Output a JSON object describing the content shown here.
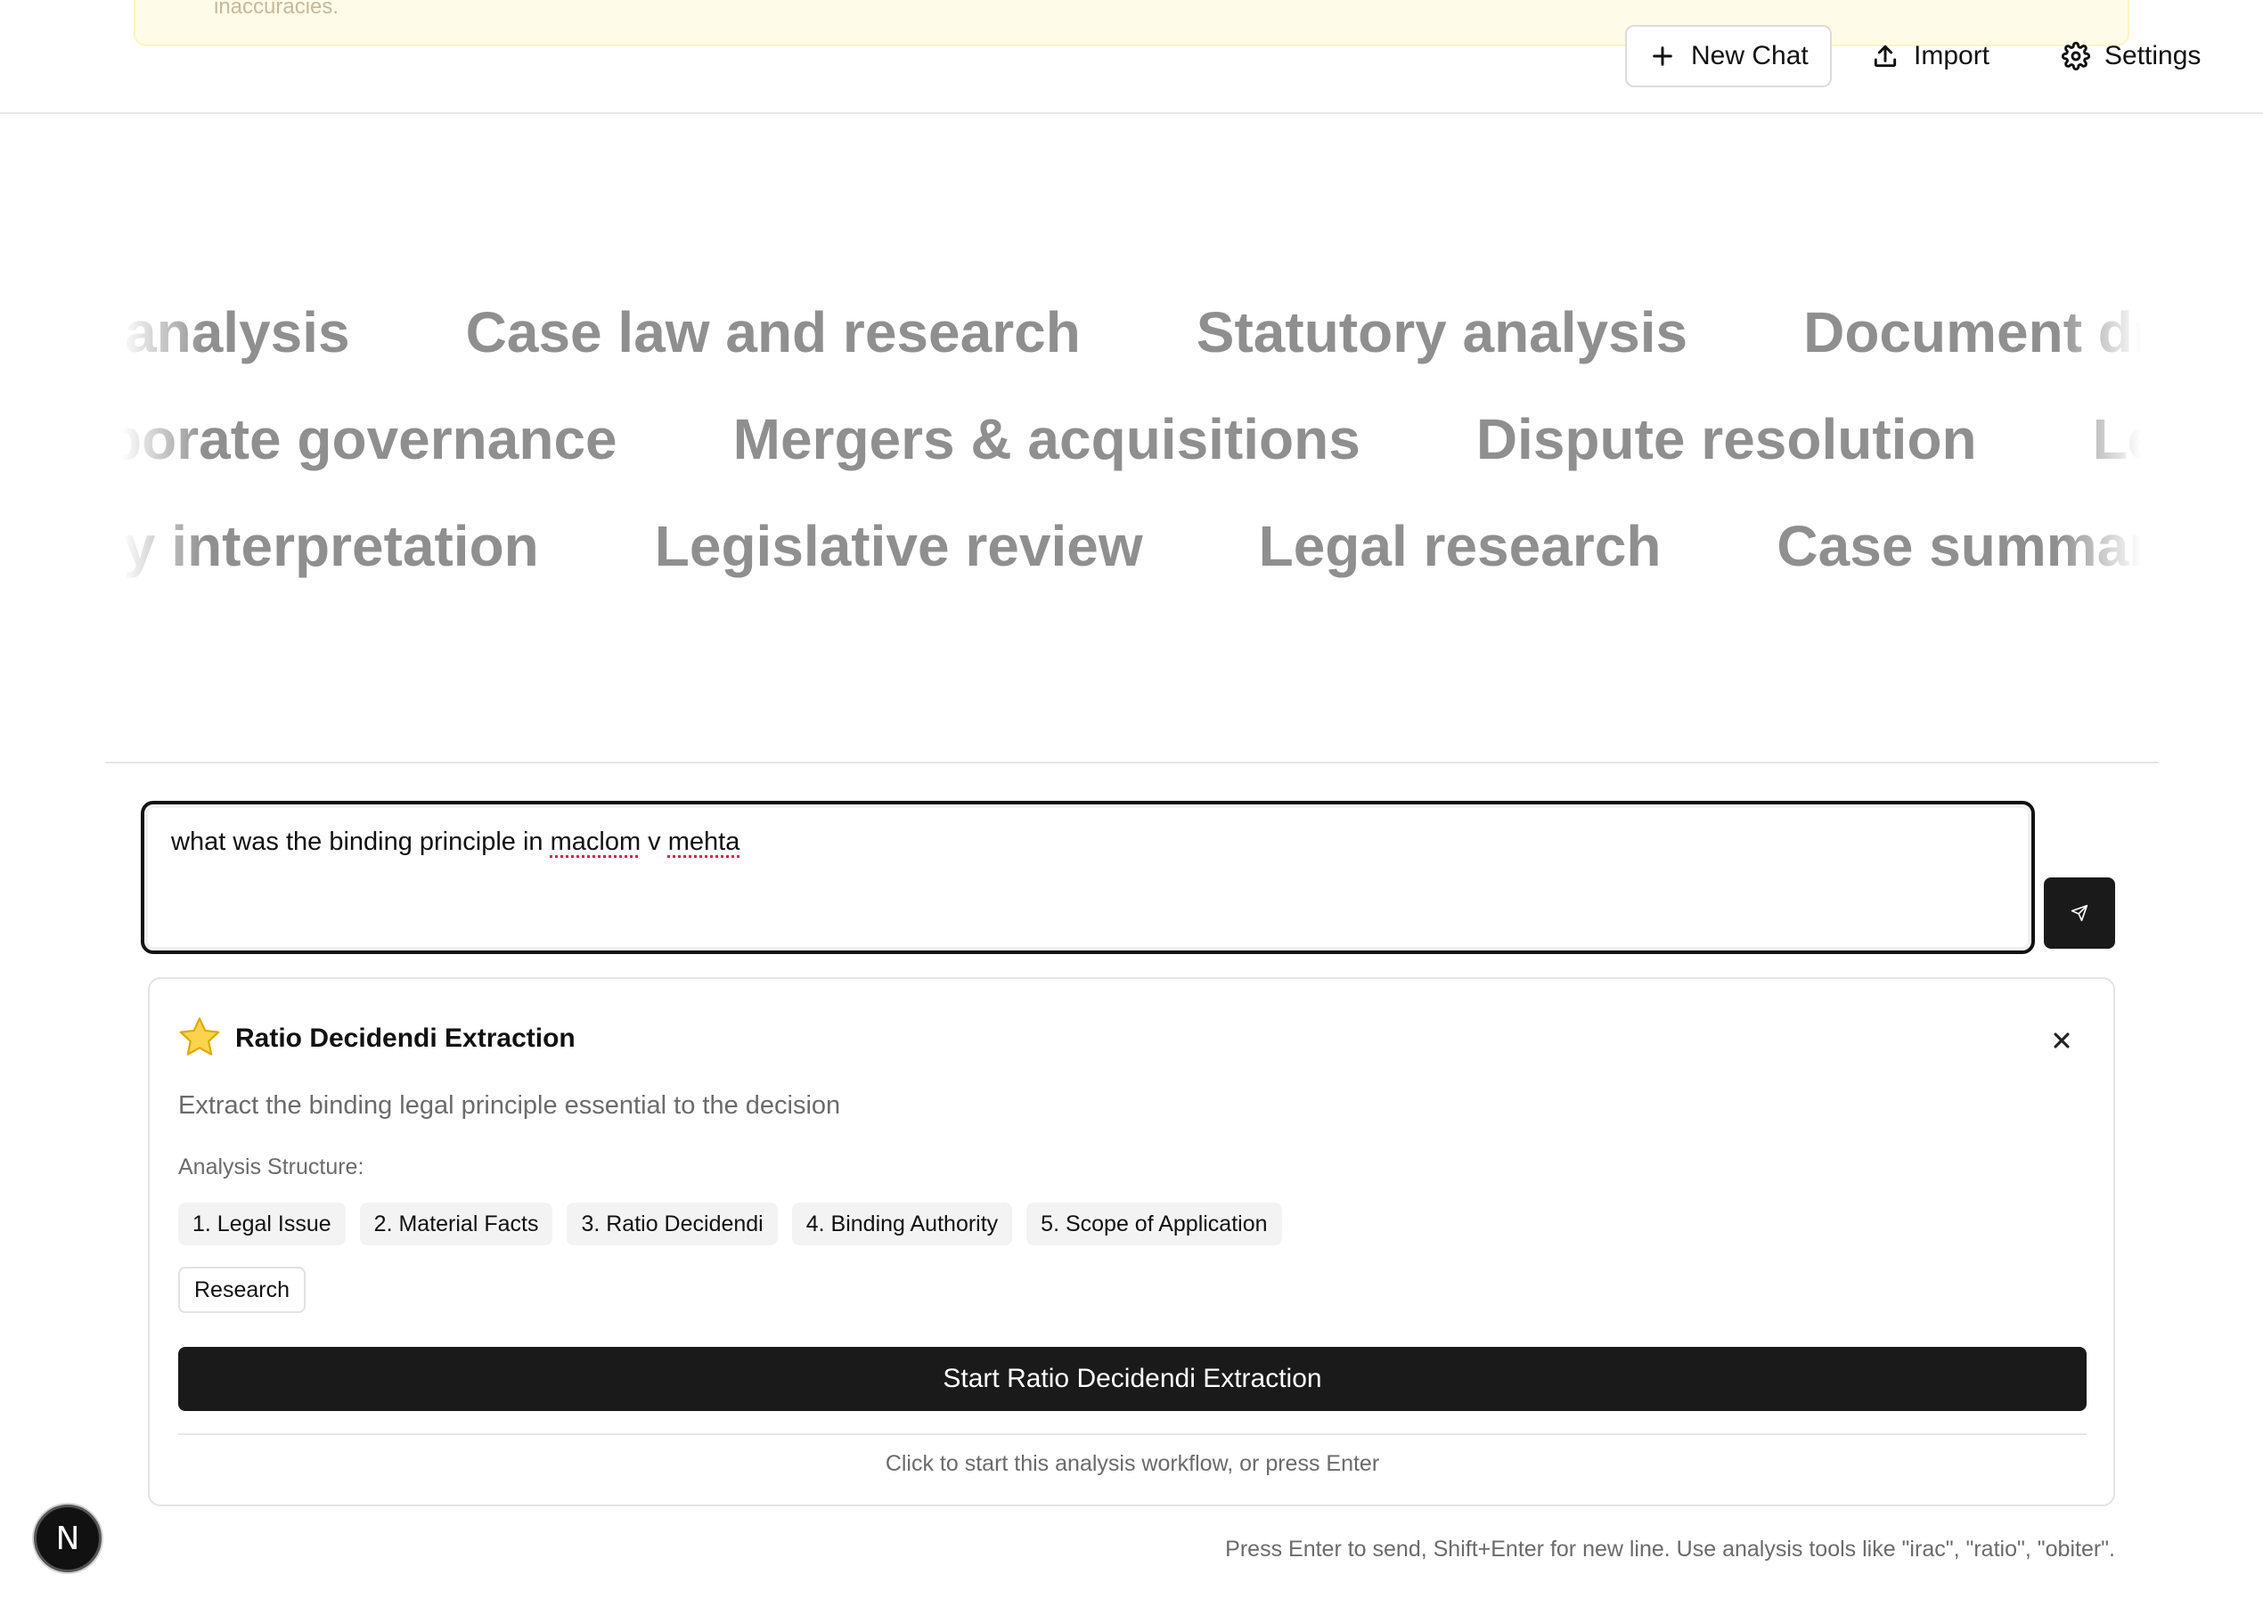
{
  "notice": {
    "text": "inaccuracies."
  },
  "header": {
    "new_chat_label": "New Chat",
    "import_label": "Import",
    "settings_label": "Settings"
  },
  "marquee": {
    "row1": [
      "analysis",
      "Case law and research",
      "Statutory analysis",
      "Document drafti"
    ],
    "row2": [
      "porate governance",
      "Mergers & acquisitions",
      "Dispute resolution",
      "Legal"
    ],
    "row3": [
      "ry interpretation",
      "Legislative review",
      "Legal research",
      "Case summaries"
    ]
  },
  "input": {
    "value_pre": "what was the binding principle in ",
    "value_word1": "maclom",
    "value_mid": " v ",
    "value_word2": "mehta"
  },
  "tool_card": {
    "icon": "star-icon",
    "title": "Ratio Decidendi Extraction",
    "description": "Extract the binding legal principle essential to the decision",
    "structure_label": "Analysis Structure:",
    "steps": [
      "1. Legal Issue",
      "2. Material Facts",
      "3. Ratio Decidendi",
      "4. Binding Authority",
      "5. Scope of Application"
    ],
    "tag": "Research",
    "start_label": "Start Ratio Decidendi Extraction",
    "hint": "Click to start this analysis workflow, or press Enter"
  },
  "footer_hint": "Press Enter to send, Shift+Enter for new line. Use analysis tools like \"irac\", \"ratio\", \"obiter\".",
  "avatar_letter": "N",
  "colors": {
    "accent": "#1a1a1a",
    "notice_bg": "#fefce8",
    "marquee_text": "#8f8f8f"
  }
}
